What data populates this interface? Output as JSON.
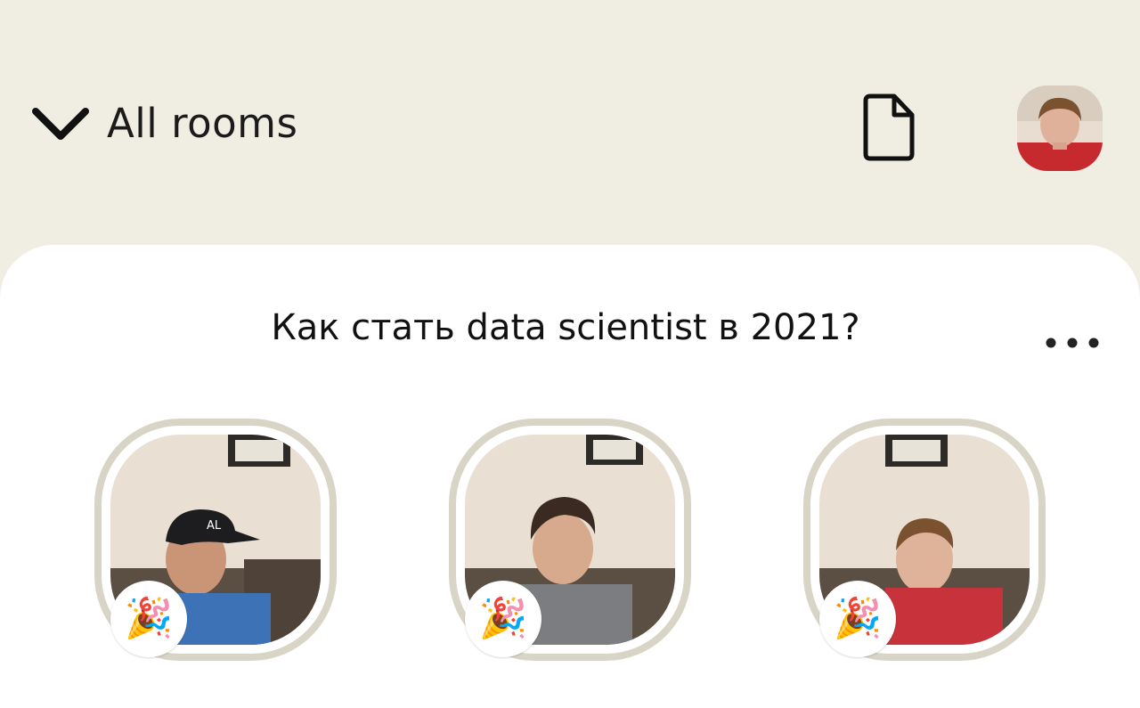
{
  "header": {
    "rooms_label": "All rooms",
    "toggle_icon": "chevron-down-icon",
    "document_icon": "document-icon",
    "profile_avatar": "avatar"
  },
  "room": {
    "title": "Как стать data scientist в 2021?",
    "more_icon": "more-horizontal-icon",
    "speakers": [
      {
        "badge": "🎉",
        "badge_icon": "party-popper-icon"
      },
      {
        "badge": "🎉",
        "badge_icon": "party-popper-icon"
      },
      {
        "badge": "🎉",
        "badge_icon": "party-popper-icon"
      }
    ]
  },
  "colors": {
    "background": "#f0ede3",
    "card": "#ffffff",
    "ring": "#d8d4c6",
    "text": "#111111"
  }
}
